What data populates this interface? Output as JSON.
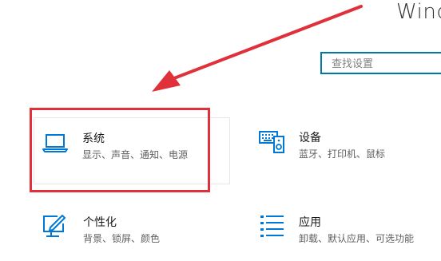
{
  "window": {
    "title": "Windows"
  },
  "search": {
    "placeholder": "查找设置",
    "value": ""
  },
  "tiles": [
    {
      "title": "系统",
      "subtitle": "显示、声音、通知、电源",
      "icon": "laptop-icon"
    },
    {
      "title": "设备",
      "subtitle": "蓝牙、打印机、鼠标",
      "icon": "keyboard-speaker-icon"
    },
    {
      "title": "个性化",
      "subtitle": "背景、锁屏、颜色",
      "icon": "pen-screen-icon"
    },
    {
      "title": "应用",
      "subtitle": "卸载、默认应用、可选功能",
      "icon": "app-list-icon"
    }
  ],
  "colors": {
    "accent": "#0078d7",
    "search_border": "#0078a8",
    "highlight": "#e0303a"
  }
}
